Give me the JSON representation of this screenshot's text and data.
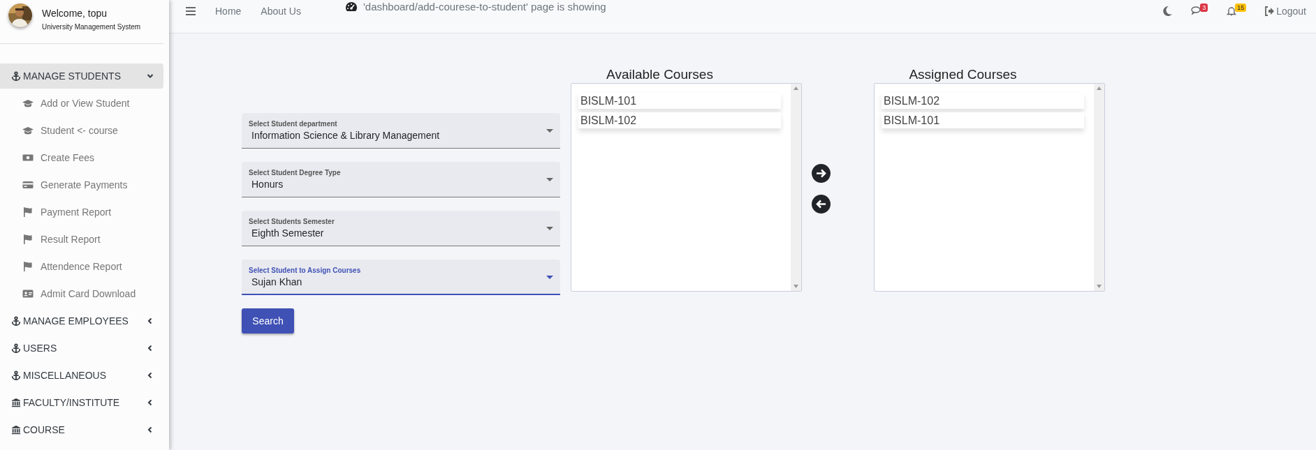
{
  "sidebar": {
    "user": {
      "welcome": "Welcome, topu",
      "subtitle": "University Management System"
    },
    "menu": [
      {
        "label": "MANAGE STUDENTS",
        "kind": "anchor",
        "expanded": true,
        "children": [
          {
            "label": "Add or View Student",
            "kind": "cap"
          },
          {
            "label": "Student <- course",
            "kind": "cap"
          },
          {
            "label": "Create Fees",
            "kind": "money"
          },
          {
            "label": "Generate Payments",
            "kind": "card"
          },
          {
            "label": "Payment Report",
            "kind": "flag"
          },
          {
            "label": "Result Report",
            "kind": "flag"
          },
          {
            "label": "Attendence Report",
            "kind": "flag"
          },
          {
            "label": "Admit Card Download",
            "kind": "idcard"
          }
        ]
      },
      {
        "label": "MANAGE EMPLOYEES",
        "kind": "anchor",
        "expanded": false
      },
      {
        "label": "USERS",
        "kind": "anchor",
        "expanded": false
      },
      {
        "label": "MISCELLANEOUS",
        "kind": "anchor",
        "expanded": false
      },
      {
        "label": "FACULTY/INSTITUTE",
        "kind": "bank",
        "expanded": false
      },
      {
        "label": "COURSE",
        "kind": "bank",
        "expanded": false
      }
    ]
  },
  "topbar": {
    "nav_links": [
      "Home",
      "About Us"
    ],
    "page_status": "'dashboard/add-courese-to-student' page is showing",
    "indicators": [
      {
        "kind": "messages",
        "count": "3",
        "color": "#dc3545"
      },
      {
        "kind": "notifications",
        "count": "15",
        "color": "#ffc107"
      }
    ],
    "logout": "Logout"
  },
  "form": {
    "fields": [
      {
        "label": "Select Student department",
        "value": "Information Science & Library Management",
        "focused": false
      },
      {
        "label": "Select Student Degree Type",
        "value": "Honurs",
        "focused": false
      },
      {
        "label": "Select Students Semester",
        "value": "Eighth Semester",
        "focused": false
      },
      {
        "label": "Select Student to Assign Courses",
        "value": "Sujan Khan",
        "focused": true
      }
    ],
    "button": "Search"
  },
  "available": {
    "title": "Available Courses",
    "items": [
      "BISLM-101",
      "BISLM-102"
    ]
  },
  "assigned": {
    "title": "Assigned Courses",
    "items": [
      "BISLM-102",
      "BISLM-101"
    ]
  }
}
